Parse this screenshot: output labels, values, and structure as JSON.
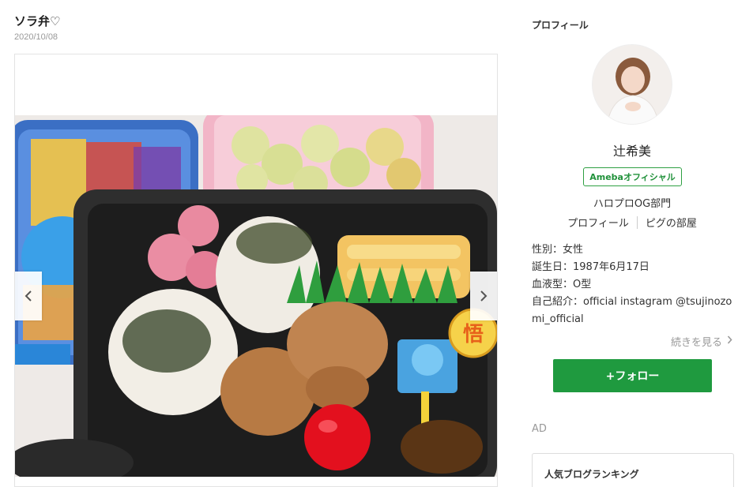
{
  "post": {
    "title": "ソラ弁♡",
    "date": "2020/10/08"
  },
  "gallery": {
    "prev_icon": "chevron-left-icon",
    "next_icon": "chevron-right-icon",
    "badge_glyph": "悟"
  },
  "profile": {
    "heading": "プロフィール",
    "name": "辻希美",
    "badge": "Amebaオフィシャル",
    "category": "ハロプロOG部門",
    "links": [
      "プロフィール",
      "ピグの部屋"
    ],
    "info": [
      "性別：女性",
      "誕生日：1987年6月17日",
      "血液型：O型",
      "自己紹介：official instagram @tsujinozomi_official"
    ],
    "read_more": "続きを見る",
    "follow_label": "+フォロー"
  },
  "ad": {
    "label": "AD",
    "ranking_title": "人気ブログランキング"
  },
  "colors": {
    "accent_green": "#1f9a3f",
    "badge_green": "#20913a"
  }
}
